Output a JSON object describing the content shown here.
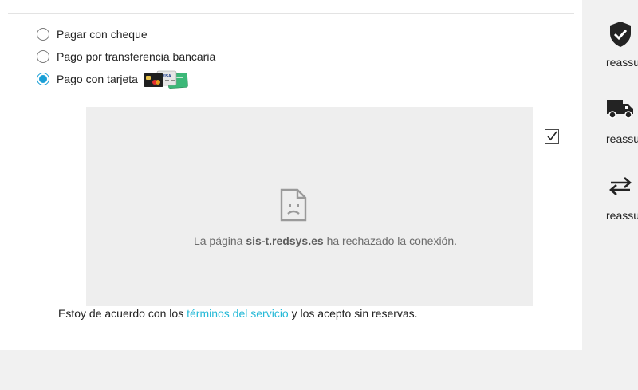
{
  "payment": {
    "options": [
      {
        "label": "Pagar con cheque",
        "selected": false
      },
      {
        "label": "Pago por transferencia bancaria",
        "selected": false
      },
      {
        "label": "Pago con tarjeta",
        "selected": true
      }
    ],
    "card_logo_text": "VISA"
  },
  "iframe": {
    "message_prefix": "La página",
    "message_host": "sis-t.redsys.es",
    "message_suffix": "ha rechazado la conexión."
  },
  "terms": {
    "checked": true,
    "before": "Estoy de acuerdo con los",
    "link": "términos del servicio",
    "after": "y los acepto sin reservas."
  },
  "reassurance": [
    {
      "icon": "shield-check-icon",
      "text": "reassurance"
    },
    {
      "icon": "truck-icon",
      "text": "reassurance"
    },
    {
      "icon": "exchange-arrows-icon",
      "text": "reassurance"
    }
  ],
  "colors": {
    "accent": "#1a9fd6",
    "link": "#24b9d7",
    "iframe_bg": "#eeeeee",
    "page_bg": "#f1f1f1"
  }
}
